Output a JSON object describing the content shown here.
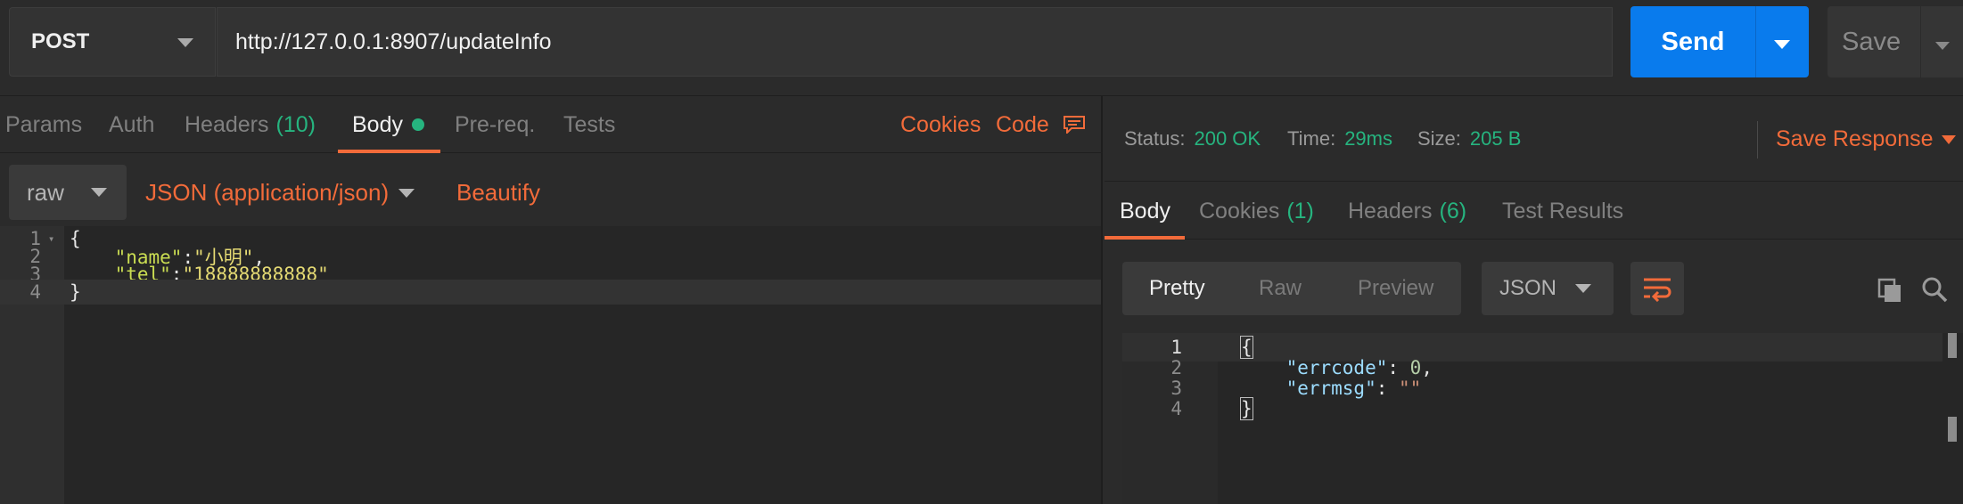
{
  "request": {
    "method": "POST",
    "url": "http://127.0.0.1:8907/updateInfo",
    "send_label": "Send",
    "save_label": "Save"
  },
  "request_tabs": {
    "params": "Params",
    "auth": "Auth",
    "headers": "Headers",
    "headers_count": "(10)",
    "body": "Body",
    "prereq": "Pre-req.",
    "tests": "Tests",
    "cookies": "Cookies",
    "code": "Code"
  },
  "body_options": {
    "mode": "raw",
    "content_type": "JSON (application/json)",
    "beautify": "Beautify"
  },
  "request_body": {
    "line_numbers": [
      "1",
      "2",
      "3",
      "4"
    ],
    "open_brace": "{",
    "name_key": "\"name\"",
    "name_value": "\"小明\"",
    "tel_key": "\"tel\"",
    "tel_value": "\"18888888888\"",
    "close_brace": "}"
  },
  "response_status": {
    "status_label": "Status:",
    "status_value": "200 OK",
    "time_label": "Time:",
    "time_value": "29ms",
    "size_label": "Size:",
    "size_value": "205 B",
    "save_response": "Save Response"
  },
  "response_tabs": {
    "body": "Body",
    "cookies": "Cookies",
    "cookies_count": "(1)",
    "headers": "Headers",
    "headers_count": "(6)",
    "test_results": "Test Results"
  },
  "response_view": {
    "pretty": "Pretty",
    "raw": "Raw",
    "preview": "Preview",
    "format": "JSON"
  },
  "response_body": {
    "line_numbers": [
      "1",
      "2",
      "3",
      "4"
    ],
    "open_brace": "{",
    "errcode_key": "\"errcode\"",
    "errcode_value": "0",
    "errmsg_key": "\"errmsg\"",
    "errmsg_value": "\"\"",
    "close_brace": "}"
  },
  "colors": {
    "accent": "#f26b3a",
    "send_blue": "#097bed",
    "success_green": "#26b47f",
    "background": "#2b2b2b"
  },
  "icons": {
    "method_dropdown": "chevron-down-icon",
    "comment": "comment-icon",
    "wrap": "wrap-lines-icon",
    "copy": "copy-icon",
    "search": "search-icon"
  }
}
